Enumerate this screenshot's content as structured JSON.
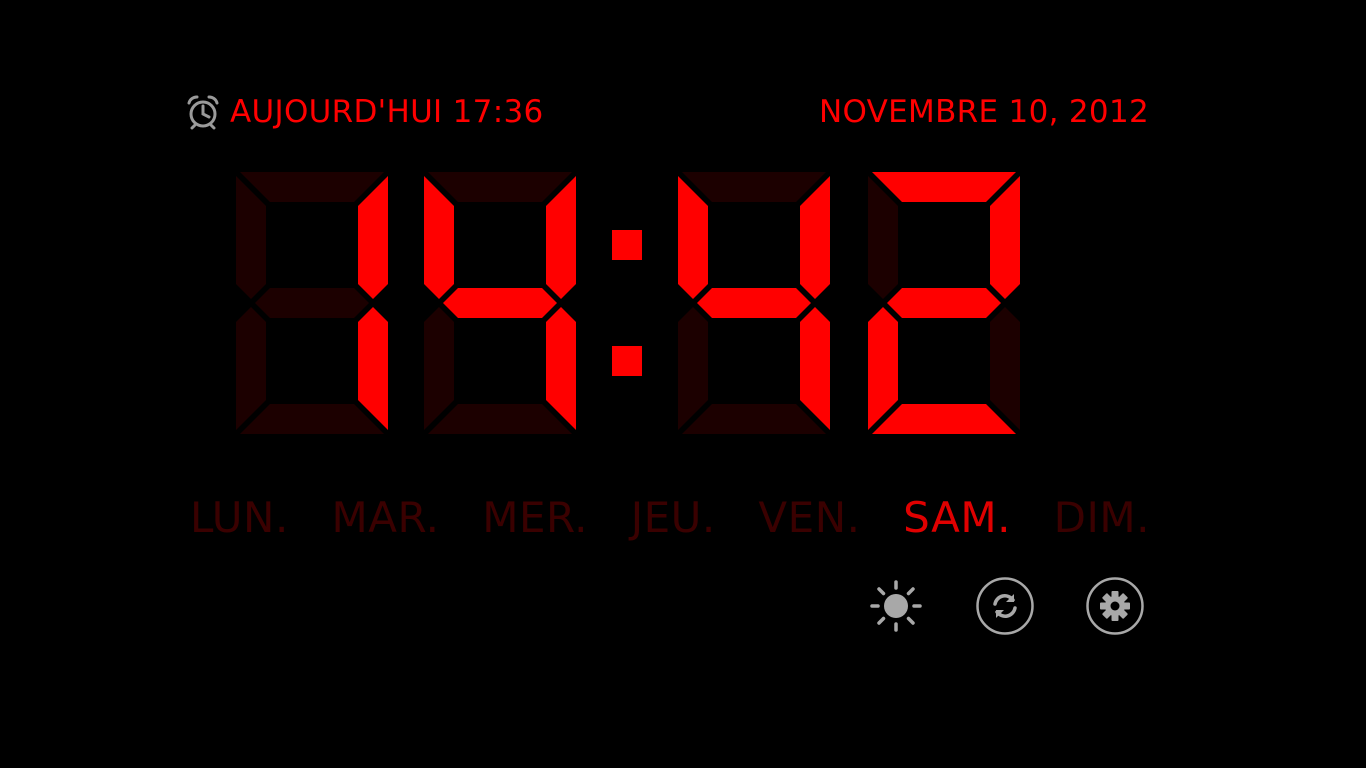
{
  "alarm": {
    "icon": "alarm-clock-icon",
    "label": "AUJOURD'HUI 17:36"
  },
  "date": {
    "label": "NOVEMBRE 10, 2012"
  },
  "clock": {
    "time": "14:42",
    "hour_leading_blank": true,
    "segment_on_color": "#ff0000",
    "segment_off_color": "#1c0000",
    "colon_color": "#ff0000"
  },
  "days": [
    {
      "label": "LUN.",
      "active": false
    },
    {
      "label": "MAR.",
      "active": false
    },
    {
      "label": "MER.",
      "active": false
    },
    {
      "label": "JEU.",
      "active": false
    },
    {
      "label": "VEN.",
      "active": false
    },
    {
      "label": "SAM.",
      "active": true
    },
    {
      "label": "DIM.",
      "active": false
    }
  ],
  "controls": [
    {
      "icon": "brightness-icon"
    },
    {
      "icon": "refresh-icon"
    },
    {
      "icon": "settings-gear-icon"
    }
  ],
  "colors": {
    "background": "#000000",
    "accent": "#ff0000",
    "inactive_day": "#3a0000",
    "icon_gray": "#a0a0a0"
  }
}
